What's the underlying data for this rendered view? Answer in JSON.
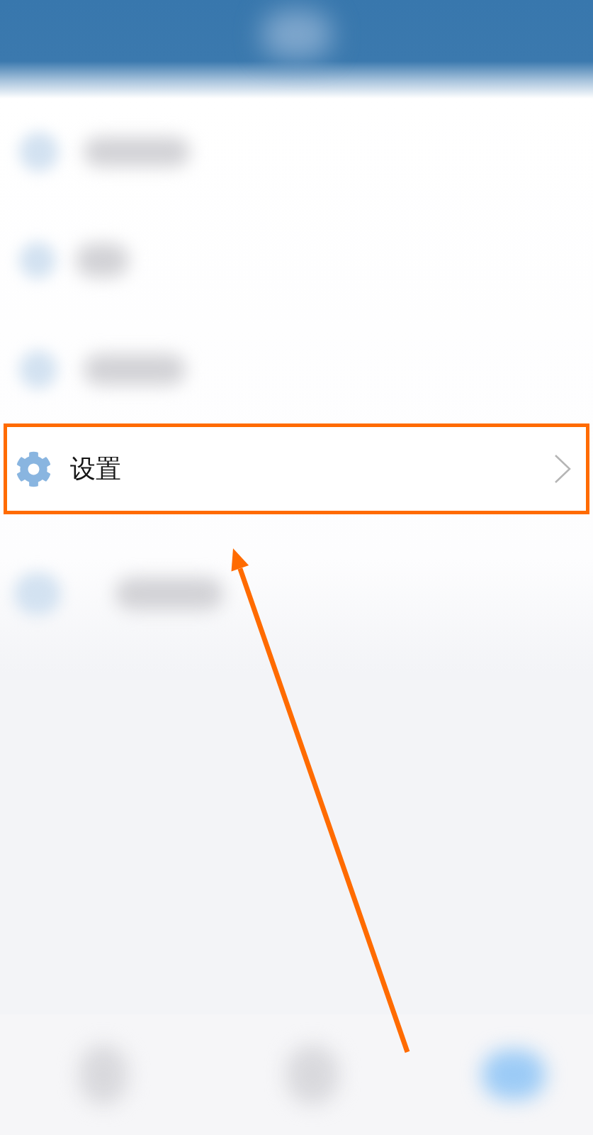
{
  "menu": {
    "items": [
      {
        "kind": "blurred"
      },
      {
        "kind": "blurred"
      },
      {
        "kind": "blurred"
      },
      {
        "kind": "entry",
        "label": "设置",
        "highlighted": true
      },
      {
        "kind": "blurred"
      }
    ]
  },
  "annotation": {
    "arrow": true
  },
  "bottom_nav": {
    "items": [
      {
        "selected": false
      },
      {
        "selected": false
      },
      {
        "selected": true
      }
    ]
  }
}
